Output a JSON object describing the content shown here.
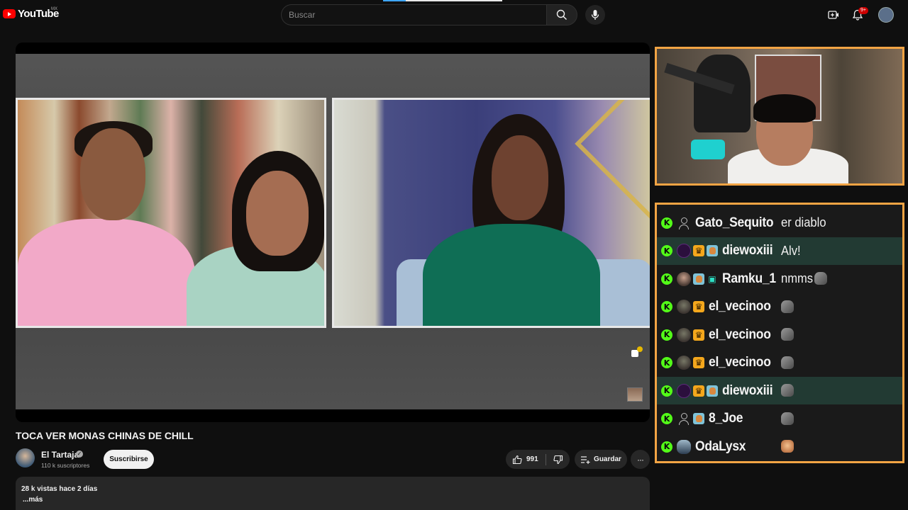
{
  "header": {
    "logo_text": "YouTube",
    "country_code": "MX",
    "search_placeholder": "Buscar",
    "notification_count": "9+",
    "icons": {
      "search": "search-icon",
      "mic": "mic-icon",
      "create": "create-video-icon",
      "notifications": "bell-icon"
    },
    "brand_color": "#ff0000"
  },
  "overlay_chat": {
    "accent_color": "#f2a444",
    "platform_icon": "kick-icon",
    "messages": [
      {
        "user": "Gato_Sequito",
        "text": "er diablo",
        "highlight": false,
        "avatar": "guest",
        "badges": []
      },
      {
        "user": "diewoxiii",
        "text": "Alv!",
        "highlight": true,
        "avatar": "dwx",
        "badges": [
          "crown",
          "pkm"
        ]
      },
      {
        "user": "Ramku_1",
        "text": "nmms",
        "highlight": false,
        "avatar": "ram",
        "badges": [
          "pkm",
          "gift"
        ],
        "emote": "gray"
      },
      {
        "user": "el_vecinoo",
        "text": "",
        "highlight": false,
        "avatar": "vec",
        "badges": [
          "crown"
        ],
        "emote": "gray"
      },
      {
        "user": "el_vecinoo",
        "text": "",
        "highlight": false,
        "avatar": "vec",
        "badges": [
          "crown"
        ],
        "emote": "gray"
      },
      {
        "user": "el_vecinoo",
        "text": "",
        "highlight": false,
        "avatar": "vec",
        "badges": [
          "crown"
        ],
        "emote": "gray"
      },
      {
        "user": "diewoxiii",
        "text": "",
        "highlight": true,
        "avatar": "dwx",
        "badges": [
          "crown",
          "pkm"
        ],
        "emote": "gray"
      },
      {
        "user": "8_Joe",
        "text": "",
        "highlight": false,
        "avatar": "guest",
        "badges": [
          "pkm"
        ],
        "emote": "gray"
      },
      {
        "user": "OdaLysx",
        "text": "",
        "highlight": false,
        "avatar": "oda",
        "badges": [],
        "emote": "face"
      }
    ]
  },
  "video": {
    "title": "TOCA VER MONAS CHINAS DE CHILL",
    "channel": {
      "name": "El Tartaja",
      "subscribers": "110 k suscriptores",
      "subscribe_label": "Suscribirse"
    },
    "likes": "991",
    "save_label": "Guardar",
    "more_label": "···",
    "description": {
      "meta": "28 k vistas  hace 2 días",
      "more": "...más"
    }
  }
}
